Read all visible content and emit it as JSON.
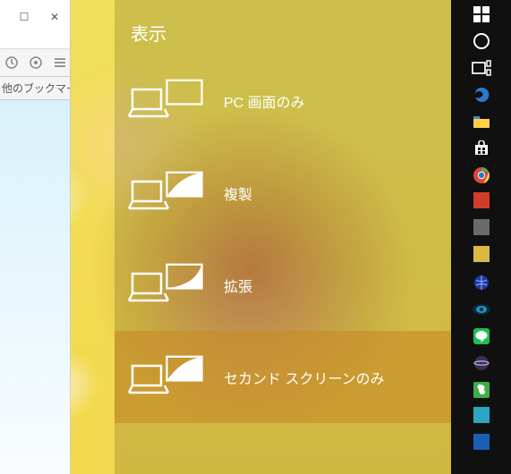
{
  "browser": {
    "maximize_glyph": "☐",
    "close_glyph": "✕",
    "bookmark_label": "他のブックマーク"
  },
  "flyout": {
    "title": "表示",
    "options": [
      {
        "label": "PC 画面のみ",
        "selected": false,
        "mode": "pc-only"
      },
      {
        "label": "複製",
        "selected": false,
        "mode": "duplicate"
      },
      {
        "label": "拡張",
        "selected": false,
        "mode": "extend"
      },
      {
        "label": "セカンド スクリーンのみ",
        "selected": true,
        "mode": "second-only"
      }
    ]
  },
  "taskbar": {
    "items": [
      {
        "name": "start",
        "color": "#ffffff"
      },
      {
        "name": "cortana",
        "color": "#ffffff"
      },
      {
        "name": "task-view",
        "color": "#ffffff"
      },
      {
        "name": "edge",
        "color": "#2a7bd0"
      },
      {
        "name": "file-explorer",
        "color": "#ffcf48"
      },
      {
        "name": "store",
        "color": "#ffffff"
      },
      {
        "name": "chrome",
        "color": ""
      },
      {
        "name": "app-red",
        "color": "#d43c2a"
      },
      {
        "name": "app-grey",
        "color": "#6a6a6a"
      },
      {
        "name": "app-yellow-tile",
        "color": "#d9b93e"
      },
      {
        "name": "app-blue-globe",
        "color": "#1f3aa8"
      },
      {
        "name": "app-eye",
        "color": "#2490b8"
      },
      {
        "name": "line",
        "color": "#19c152"
      },
      {
        "name": "eclipse",
        "color": "#3a2d54"
      },
      {
        "name": "evernote",
        "color": "#3fae47"
      },
      {
        "name": "app-cyan",
        "color": "#2aa7c3"
      },
      {
        "name": "app-blue",
        "color": "#1a5fb4"
      }
    ]
  }
}
